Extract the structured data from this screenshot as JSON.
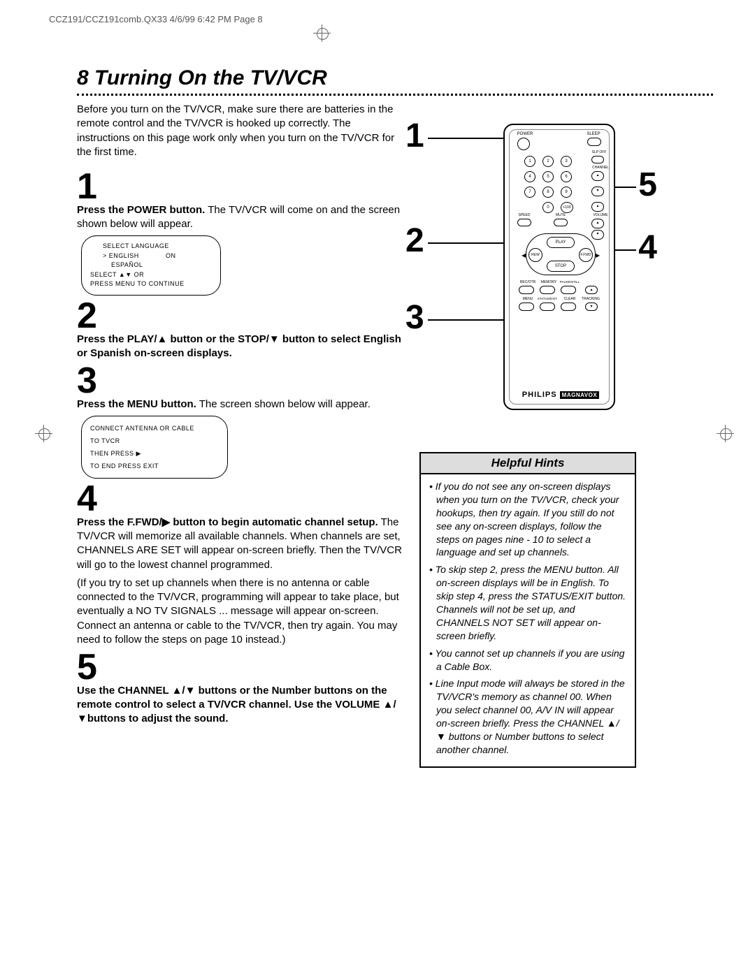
{
  "header": "CCZ191/CCZ191comb.QX33  4/6/99 6:42 PM  Page 8",
  "page_number": "8",
  "title": "Turning On the TV/VCR",
  "intro": "Before you turn on the TV/VCR, make sure there are batteries in the remote control and the TV/VCR is hooked up correctly. The instructions on this page work only when you turn on the TV/VCR for the first time.",
  "steps": {
    "s1": {
      "num": "1",
      "bold": "Press the POWER button.",
      "rest": " The TV/VCR will come on and the screen shown below will appear."
    },
    "s2": {
      "num": "2",
      "bold": "Press the PLAY/▲ button or the STOP/▼ button to select English or Spanish on-screen displays."
    },
    "s3": {
      "num": "3",
      "bold": "Press the MENU button.",
      "rest": " The screen shown below will appear."
    },
    "s4": {
      "num": "4",
      "bold": "Press the F.FWD/▶ button to begin automatic channel setup.",
      "rest": " The TV/VCR will memorize all available channels. When channels are set, CHANNELS ARE SET will appear on-screen briefly. Then the TV/VCR will go to the lowest channel programmed.",
      "note": "(If you try to set up channels when there is no antenna or cable connected to the TV/VCR, programming will appear to take place, but eventually a NO TV SIGNALS ... message will appear on-screen. Connect an antenna or cable to the TV/VCR, then try again. You may need to follow the steps on page 10 instead.)"
    },
    "s5": {
      "num": "5",
      "bold": "Use the CHANNEL ▲/▼ buttons or the Number buttons on the remote control to select a TV/VCR channel. Use the VOLUME ▲/▼buttons to adjust the sound."
    }
  },
  "osd1": {
    "title": "SELECT LANGUAGE",
    "row1a": "> ENGLISH",
    "row1b": "ON",
    "row2": "ESPAÑOL",
    "foot1": "SELECT ▲▼ OR",
    "foot2": "PRESS MENU TO CONTINUE"
  },
  "osd2": {
    "l1": "CONNECT ANTENNA OR CABLE",
    "l2": "TO TVCR",
    "l3": "THEN PRESS ▶",
    "l4": "TO END PRESS EXIT"
  },
  "remote": {
    "power": "POWER",
    "sleep": "SLEEP",
    "slpoff": "SLP OFF",
    "channel": "CHANNEL",
    "plus100": "+100",
    "speed": "SPEED",
    "mute": "MUTE",
    "volume": "VOLUME",
    "play": "PLAY",
    "rew": "REW",
    "ffwd": "F.FWD",
    "stop": "STOP",
    "recotr": "REC/OTR",
    "memory": "MEMORY",
    "pause": "PAUSE/STILL",
    "menu": "MENU",
    "status": "STATUS/EXIT",
    "clear": "CLEAR",
    "tracking": "TRACKING",
    "brand1": "PHILIPS",
    "brand2": "MAGNAVOX",
    "n1": "1",
    "n2": "2",
    "n3": "3",
    "n4": "4",
    "n5": "5",
    "n6": "6",
    "n7": "7",
    "n8": "8",
    "n9": "9",
    "n0": "0"
  },
  "callouts": {
    "c1": "1",
    "c2": "2",
    "c3": "3",
    "c4": "4",
    "c5": "5"
  },
  "hints": {
    "title": "Helpful Hints",
    "items": [
      "If you do not see any on-screen displays when you turn on the TV/VCR, check your hookups, then try again. If you still do not see any on-screen displays, follow the steps on pages nine - 10 to select a language and set up channels.",
      "To skip step 2, press the MENU button. All on-screen displays will be in English. To skip step 4, press the STATUS/EXIT button. Channels will not be set up, and CHANNELS NOT SET will appear on-screen briefly.",
      "You cannot set up channels if you are using a Cable Box.",
      "Line Input mode will always be stored in the TV/VCR's memory as channel 00. When you select channel 00, A/V IN will appear on-screen briefly. Press the CHANNEL ▲/▼ buttons or Number buttons to select another channel."
    ]
  }
}
